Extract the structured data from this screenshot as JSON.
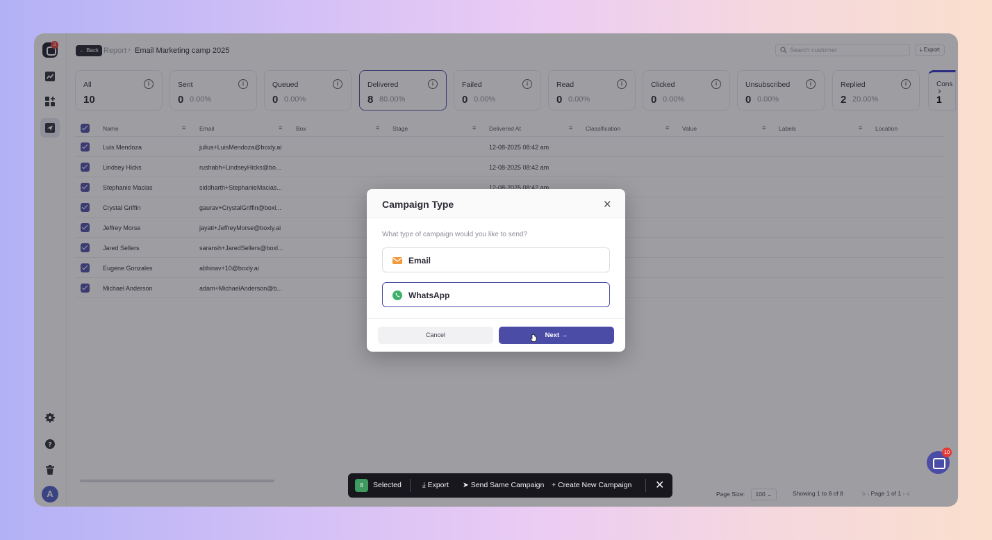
{
  "sidebar": {
    "logo_badge": "3",
    "avatar_initial": "A"
  },
  "header": {
    "back_label": "← Back",
    "breadcrumb_parent": "Report",
    "breadcrumb_current": "Email Marketing camp 2025",
    "search_placeholder": "Search customer",
    "export_label": "Export"
  },
  "stat_cards": [
    {
      "label": "All",
      "count": "10",
      "percent": ""
    },
    {
      "label": "Sent",
      "count": "0",
      "percent": "0.00%"
    },
    {
      "label": "Queued",
      "count": "0",
      "percent": "0.00%"
    },
    {
      "label": "Delivered",
      "count": "8",
      "percent": "80.00%"
    },
    {
      "label": "Failed",
      "count": "0",
      "percent": "0.00%"
    },
    {
      "label": "Read",
      "count": "0",
      "percent": "0.00%"
    },
    {
      "label": "Clicked",
      "count": "0",
      "percent": "0.00%"
    },
    {
      "label": "Unsubscribed",
      "count": "0",
      "percent": "0.00%"
    },
    {
      "label": "Replied",
      "count": "2",
      "percent": "20.00%"
    }
  ],
  "stat_card_peek": {
    "label": "Cons",
    "count": "1"
  },
  "table": {
    "columns": [
      "Name",
      "Email",
      "Box",
      "Stage",
      "Delivered At",
      "Classification",
      "Value",
      "Labels",
      "Location"
    ],
    "rows": [
      {
        "name": "Luis Mendoza",
        "email": "julius+LuisMendoza@boxly.ai",
        "delivered_at": "12-08-2025 08:42 am"
      },
      {
        "name": "Lindsey Hicks",
        "email": "rushabh+LindseyHicks@bo...",
        "delivered_at": "12-08-2025 08:42 am"
      },
      {
        "name": "Stephanie Macias",
        "email": "siddharth+StephanieMacias...",
        "delivered_at": "12-08-2025 08:42 am"
      },
      {
        "name": "Crystal Griffin",
        "email": "gaurav+CrystalGriffin@boxl...",
        "delivered_at": ""
      },
      {
        "name": "Jeffrey Morse",
        "email": "jayati+JeffreyMorse@boxly.ai",
        "delivered_at": ""
      },
      {
        "name": "Jared Sellers",
        "email": "saransh+JaredSellers@boxl...",
        "delivered_at": ""
      },
      {
        "name": "Eugene Gonzales",
        "email": "abhinav+10@boxly.ai",
        "delivered_at": ""
      },
      {
        "name": "Michael Anderson",
        "email": "adam+MichaelAnderson@b...",
        "delivered_at": ""
      }
    ]
  },
  "pagination": {
    "page_size_label": "Page Size:",
    "page_size_value": "100",
    "showing_text": "Showing 1 to 8 of 8",
    "page_text": "Page 1 of 1"
  },
  "selection_bar": {
    "count": "8",
    "selected_label": "Selected",
    "export_label": "Export",
    "send_same_label": "Send Same Campaign",
    "create_new_label": "Create New Campaign"
  },
  "chat": {
    "badge": "10"
  },
  "modal": {
    "title": "Campaign Type",
    "question": "What type of campaign would you like to send?",
    "options": [
      {
        "label": "Email",
        "selected": false
      },
      {
        "label": "WhatsApp",
        "selected": true
      }
    ],
    "cancel_label": "Cancel",
    "next_label": "Next →"
  },
  "colors": {
    "accent": "#4b4ca6",
    "email_icon": "#f39a3c",
    "whatsapp_icon": "#3fb26a"
  }
}
